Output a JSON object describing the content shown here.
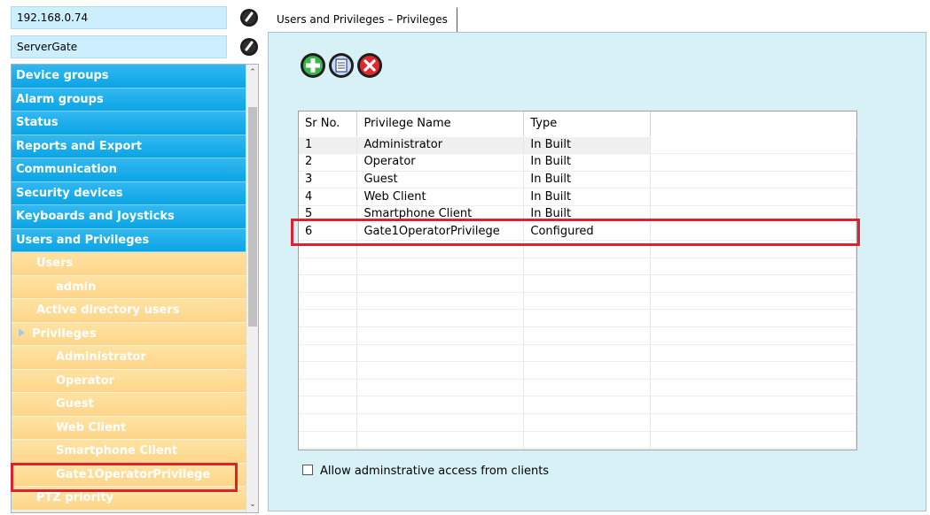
{
  "servers": [
    {
      "name": "192.168.0.74"
    },
    {
      "name": "ServerGate"
    }
  ],
  "tree": {
    "items": [
      {
        "label": "Device groups",
        "style": "blue",
        "level": 0
      },
      {
        "label": "Alarm groups",
        "style": "blue",
        "level": 0
      },
      {
        "label": "Status",
        "style": "blue",
        "level": 0
      },
      {
        "label": "Reports and Export",
        "style": "blue",
        "level": 0
      },
      {
        "label": "Communication",
        "style": "blue",
        "level": 0
      },
      {
        "label": "Security devices",
        "style": "blue",
        "level": 0
      },
      {
        "label": "Keyboards and Joysticks",
        "style": "blue",
        "level": 0
      },
      {
        "label": "Users and Privileges",
        "style": "blue",
        "level": 0
      },
      {
        "label": "Users",
        "style": "yellow",
        "level": 1
      },
      {
        "label": "admin",
        "style": "yellow",
        "level": 2
      },
      {
        "label": "Active directory users",
        "style": "yellow",
        "level": 1
      },
      {
        "label": "Privileges",
        "style": "yellow",
        "level": 1,
        "expanded": true
      },
      {
        "label": "Administrator",
        "style": "yellow",
        "level": 2
      },
      {
        "label": "Operator",
        "style": "yellow",
        "level": 2
      },
      {
        "label": "Guest",
        "style": "yellow",
        "level": 2
      },
      {
        "label": "Web Client",
        "style": "yellow",
        "level": 2
      },
      {
        "label": "Smartphone Client",
        "style": "yellow",
        "level": 2
      },
      {
        "label": "Gate1OperatorPrivilege",
        "style": "yellow",
        "level": 2,
        "highlighted": true
      },
      {
        "label": "PTZ priority",
        "style": "yellow",
        "level": 1
      }
    ]
  },
  "tab": {
    "label": "Users and Privileges – Privileges"
  },
  "toolbar": {
    "buttons": [
      {
        "icon": "add-icon",
        "color": "#2aa52a"
      },
      {
        "icon": "edit-icon",
        "color": "#1a3d8a"
      },
      {
        "icon": "delete-icon",
        "color": "#d8262d"
      }
    ]
  },
  "grid": {
    "columns": [
      "Sr No.",
      "Privilege Name",
      "Type"
    ],
    "rows": [
      {
        "sr": "1",
        "name": "Administrator",
        "type": "In Built",
        "selected": true
      },
      {
        "sr": "2",
        "name": "Operator",
        "type": "In Built"
      },
      {
        "sr": "3",
        "name": "Guest",
        "type": "In Built"
      },
      {
        "sr": "4",
        "name": "Web Client",
        "type": "In Built"
      },
      {
        "sr": "5",
        "name": "Smartphone Client",
        "type": "In Built"
      },
      {
        "sr": "6",
        "name": "Gate1OperatorPrivilege",
        "type": "Configured",
        "highlighted": true
      }
    ]
  },
  "checkbox": {
    "label": "Allow adminstrative access from clients",
    "checked": false
  },
  "colors": {
    "highlight": "#e0202a",
    "nav_blue": "#0aa4e6",
    "nav_yellow": "#fdd58a",
    "panel_bg": "#d8f1f7"
  }
}
